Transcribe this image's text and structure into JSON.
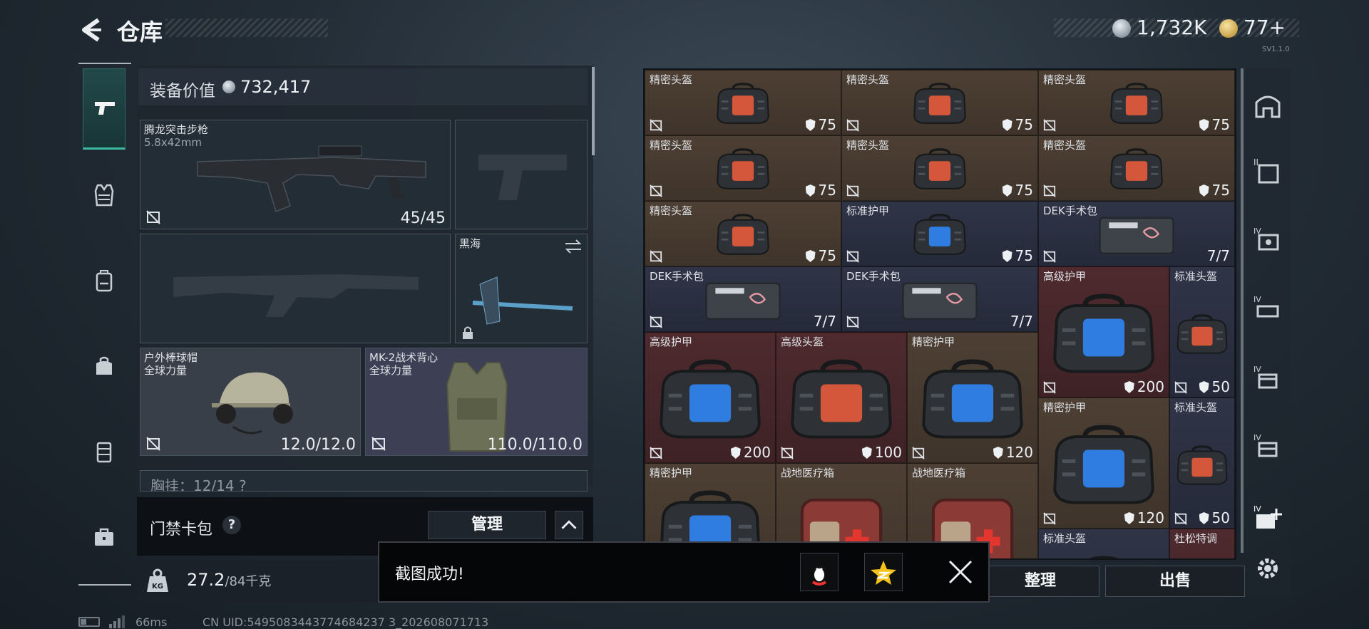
{
  "header": {
    "title": "仓库",
    "silver": "1,732K",
    "gold": "77+",
    "version_tag": "SV1.1.0"
  },
  "equipment": {
    "label": "装备价值",
    "value": "732,417",
    "rifle": {
      "name": "腾龙突击步枪",
      "caliber": "5.8x42mm",
      "ammo": "45/45"
    },
    "melee": {
      "name": "黑海"
    },
    "helmet": {
      "name": "户外棒球帽",
      "brand": "全球力量",
      "durability": "12.0/12.0"
    },
    "vest": {
      "name": "MK-2战术背心",
      "brand": "全球力量",
      "durability": "110.0/110.0"
    },
    "chest_partial": "胸挂：12/14  ?"
  },
  "card_pack": {
    "label": "门禁卡包",
    "help": "?",
    "manage": "管理"
  },
  "weight": {
    "current": "27.2",
    "max": "/84千克"
  },
  "status": {
    "ping": "66ms",
    "uid": "CN UID:5495083443774684237 3_202608071713"
  },
  "grid": {
    "items": [
      {
        "name": "精密头盔",
        "value": "75",
        "color": "brown",
        "kind": "helmet"
      },
      {
        "name": "精密头盔",
        "value": "75",
        "color": "brown",
        "kind": "helmet"
      },
      {
        "name": "精密头盔",
        "value": "75",
        "color": "brown",
        "kind": "helmet"
      },
      {
        "name": "精密头盔",
        "value": "75",
        "color": "brown",
        "kind": "helmet"
      },
      {
        "name": "精密头盔",
        "value": "75",
        "color": "brown",
        "kind": "helmet"
      },
      {
        "name": "精密头盔",
        "value": "75",
        "color": "brown",
        "kind": "helmet"
      },
      {
        "name": "精密头盔",
        "value": "75",
        "color": "brown",
        "kind": "helmet"
      },
      {
        "name": "标准护甲",
        "value": "75",
        "color": "blue",
        "kind": "armor"
      },
      {
        "name": "DEK手术包",
        "value": "7/7",
        "color": "blue",
        "kind": "medkit"
      },
      {
        "name": "DEK手术包",
        "value": "7/7",
        "color": "blue",
        "kind": "medkit"
      },
      {
        "name": "DEK手术包",
        "value": "7/7",
        "color": "blue",
        "kind": "medkit"
      },
      {
        "name": "高级护甲",
        "value": "200",
        "color": "red",
        "kind": "armor"
      },
      {
        "name": "标准头盔",
        "value": "50",
        "color": "blue",
        "kind": "helmet"
      },
      {
        "name": "高级护甲",
        "value": "200",
        "color": "red",
        "kind": "armor"
      },
      {
        "name": "高级头盔",
        "value": "100",
        "color": "red",
        "kind": "helmet"
      },
      {
        "name": "精密护甲",
        "value": "120",
        "color": "brown",
        "kind": "armor"
      },
      {
        "name": "精密护甲",
        "value": "120",
        "color": "brown",
        "kind": "armor"
      },
      {
        "name": "标准头盔",
        "value": "50",
        "color": "blue",
        "kind": "helmet"
      },
      {
        "name": "精密护甲",
        "value": "",
        "color": "brown",
        "kind": "armor"
      },
      {
        "name": "战地医疗箱",
        "value": "",
        "color": "brown",
        "kind": "firstaid"
      },
      {
        "name": "战地医疗箱",
        "value": "",
        "color": "brown",
        "kind": "firstaid"
      },
      {
        "name": "标准头盔",
        "value": "",
        "color": "blue",
        "kind": "helmet"
      },
      {
        "name": "杜松特调",
        "value": "",
        "color": "red",
        "kind": "drink"
      }
    ]
  },
  "actions": {
    "sort": "整理",
    "sell": "出售"
  },
  "toast": {
    "message": "截图成功!"
  },
  "colors": {
    "brown": "#4a3d31",
    "blue": "#2c3244",
    "red": "#4a282c",
    "accent": "#3cb9a2"
  }
}
